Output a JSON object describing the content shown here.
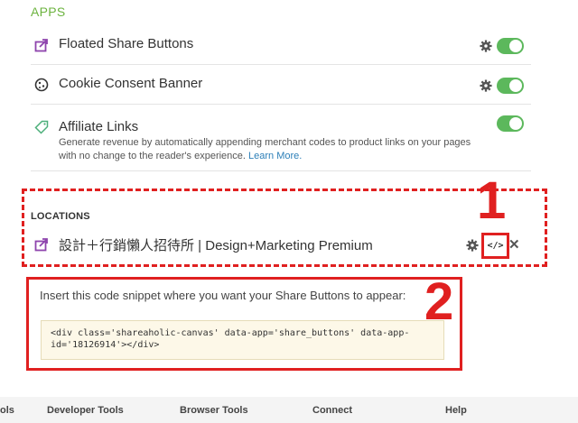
{
  "apps_section": {
    "title": "APPS",
    "items": [
      {
        "name": "Floated Share Buttons",
        "icon": "share-icon",
        "has_gear": true,
        "enabled": true
      },
      {
        "name": "Cookie Consent Banner",
        "icon": "cookie-icon",
        "has_gear": true,
        "enabled": true
      },
      {
        "name": "Affiliate Links",
        "icon": "tag-icon",
        "has_gear": false,
        "enabled": true,
        "description": "Generate revenue by automatically appending merchant codes to product links on your pages with no change to the reader's experience.",
        "link_text": "Learn More."
      }
    ]
  },
  "locations_section": {
    "title": "LOCATIONS",
    "location_name": "設計＋行銷懶人招待所 | Design+Marketing Premium",
    "code_button": "</>",
    "close_label": "✕"
  },
  "annotations": {
    "one": "1",
    "two": "2",
    "color": "#e02020"
  },
  "snippet": {
    "instruction": "Insert this code snippet where you want your Share Buttons to appear:",
    "code_line1": "<div class='shareaholic-canvas' data-app='share_buttons' data-app-",
    "code_line2": "id='18126914'></div>"
  },
  "footer": {
    "items": [
      "ols",
      "Developer Tools",
      "Browser Tools",
      "Connect",
      "Help"
    ]
  },
  "colors": {
    "accent": "#6cb33f",
    "toggle_on": "#5cb85c",
    "link": "#2c7fb8",
    "icon_purple": "#8e44ad"
  }
}
